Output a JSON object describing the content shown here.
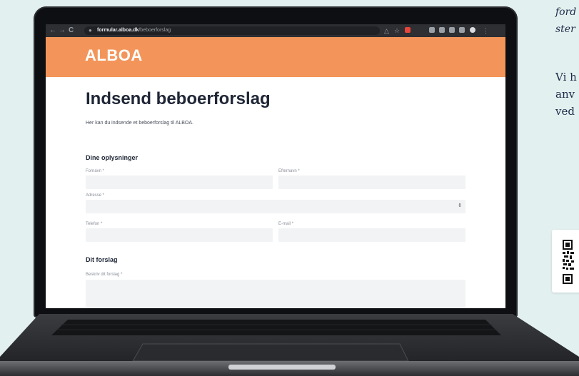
{
  "background": {
    "italic_lines": [
      "ford",
      "ster"
    ],
    "body_lines": [
      "Vi h",
      "anv",
      "ved"
    ]
  },
  "browser": {
    "url_domain": "formular.alboa.dk",
    "url_path": "/beboerforslag"
  },
  "site": {
    "logo": "ALBOA",
    "brand_color": "#f3955a"
  },
  "form": {
    "title": "Indsend beboerforslag",
    "intro": "Her kan du indsende et beboerforslag til ALBOA.",
    "section_personal": "Dine oplysninger",
    "fields": {
      "first_name": "Fornavn *",
      "last_name": "Efternavn *",
      "address": "Adresse *",
      "phone": "Telefon *",
      "email": "E-mail *",
      "proposal": "Beskriv dit forslag *"
    },
    "section_proposal": "Dit forslag"
  },
  "icons": {
    "back": "arrow-left-icon",
    "forward": "arrow-right-icon",
    "reload": "reload-icon",
    "lock": "lock-icon",
    "share": "share-icon",
    "star": "star-icon",
    "select_chevron": "chevron-updown-icon"
  }
}
